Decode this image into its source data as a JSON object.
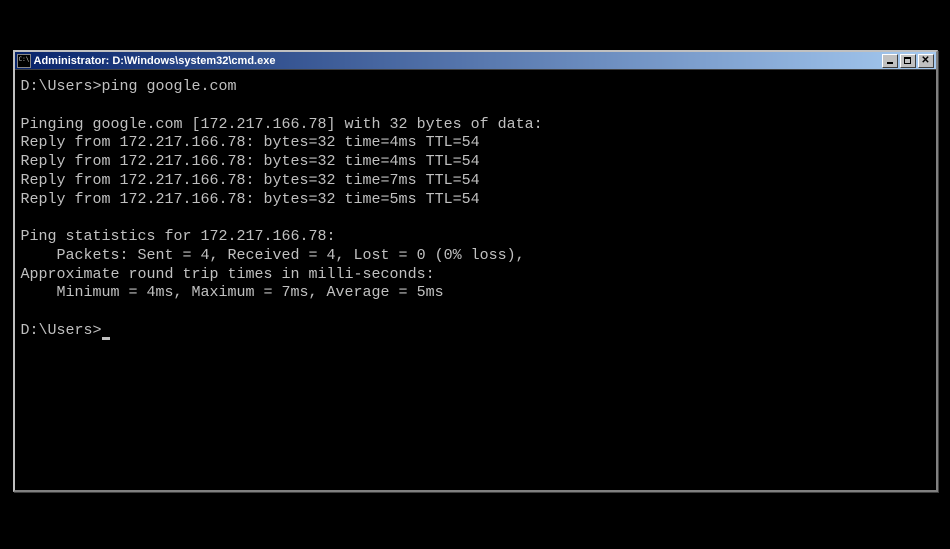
{
  "window": {
    "title": "Administrator: D:\\Windows\\system32\\cmd.exe"
  },
  "console": {
    "prompt1": "D:\\Users>",
    "command": "ping google.com",
    "blank1": "",
    "pinging_line": "Pinging google.com [172.217.166.78] with 32 bytes of data:",
    "replies": [
      "Reply from 172.217.166.78: bytes=32 time=4ms TTL=54",
      "Reply from 172.217.166.78: bytes=32 time=4ms TTL=54",
      "Reply from 172.217.166.78: bytes=32 time=7ms TTL=54",
      "Reply from 172.217.166.78: bytes=32 time=5ms TTL=54"
    ],
    "blank2": "",
    "stats_header": "Ping statistics for 172.217.166.78:",
    "packets_line": "    Packets: Sent = 4, Received = 4, Lost = 0 (0% loss),",
    "rtt_header": "Approximate round trip times in milli-seconds:",
    "rtt_line": "    Minimum = 4ms, Maximum = 7ms, Average = 5ms",
    "blank3": "",
    "prompt2": "D:\\Users>"
  }
}
